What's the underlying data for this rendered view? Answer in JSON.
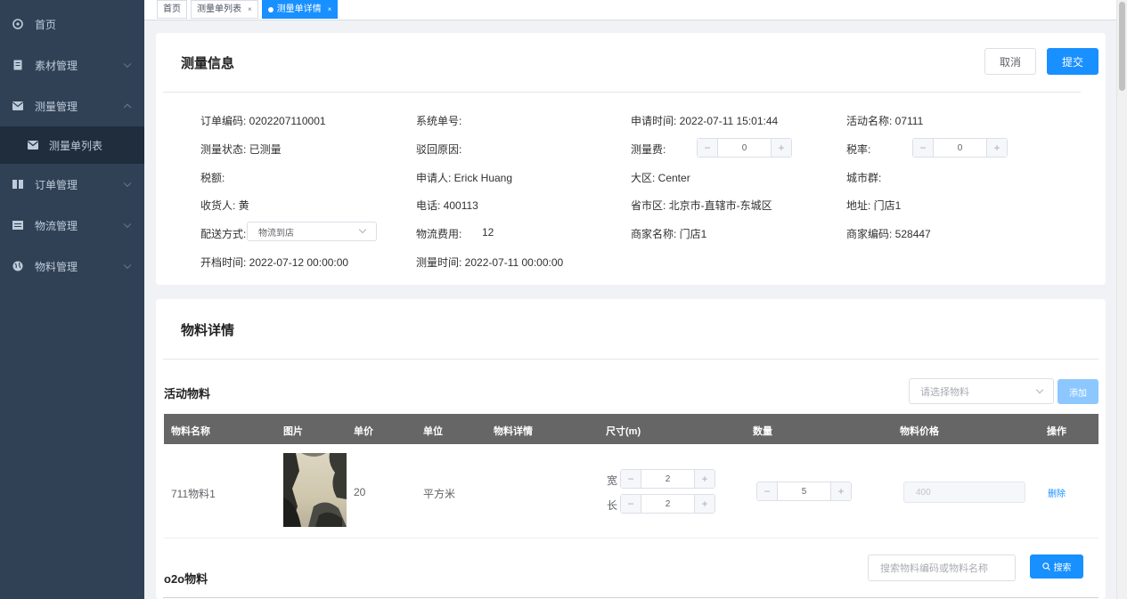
{
  "sidebar": {
    "items": [
      {
        "label": "首页",
        "icon": "dashboard-icon"
      },
      {
        "label": "素材管理",
        "icon": "document-icon"
      },
      {
        "label": "测量管理",
        "icon": "mail-icon"
      },
      {
        "label": "测量单列表",
        "icon": "mail-icon"
      },
      {
        "label": "订单管理",
        "icon": "book-icon"
      },
      {
        "label": "物流管理",
        "icon": "calendar-icon"
      },
      {
        "label": "物料管理",
        "icon": "globe-icon"
      }
    ]
  },
  "tags": {
    "home": "首页",
    "list": "测量单列表",
    "detail": "测量单详情",
    "close": "×"
  },
  "info": {
    "title": "测量信息",
    "cancel": "取消",
    "submit": "提交",
    "order_code": "订单编码: 0202207110001",
    "system_no": "系统单号:",
    "apply_time": "申请时间: 2022-07-11 15:01:44",
    "activity_name": "活动名称: 07111",
    "measure_status": "测量状态: 已测量",
    "reject_reason": "驳回原因:",
    "measure_fee_label": "测量费:",
    "measure_fee_value": "0",
    "tax_rate_label": "税率:",
    "tax_rate_value": "0",
    "tax_amount": "税额:",
    "applicant": "申请人: Erick Huang",
    "region": "大区: Center",
    "city_group": "城市群:",
    "receiver": "收货人: 黄",
    "phone": "电话: 400113",
    "province": "省市区: 北京市-直辖市-东城区",
    "address": "地址: 门店1",
    "delivery_label": "配送方式:",
    "delivery_value": "物流到店",
    "logistics_fee_label": "物流费用:",
    "logistics_fee_value": "12",
    "merchant_name": "商家名称: 门店1",
    "merchant_code": "商家编码: 528447",
    "open_time": "开档时间: 2022-07-12 00:00:00",
    "measure_time": "测量时间: 2022-07-11 00:00:00",
    "minus": "−",
    "plus": "+"
  },
  "material": {
    "title": "物料详情",
    "activity_section": "活动物料",
    "select_placeholder": "请选择物料",
    "add": "添加",
    "columns": [
      "物料名称",
      "图片",
      "单价",
      "单位",
      "物料详情",
      "尺寸(m)",
      "数量",
      "物料价格",
      "操作"
    ],
    "row": {
      "name": "711物料1",
      "price": "20",
      "unit": "平方米",
      "width_label": "宽",
      "width": "2",
      "length_label": "长",
      "length": "2",
      "quantity": "5",
      "total": "400",
      "delete": "删除"
    },
    "o2o_section": "o2o物料",
    "search_placeholder": "搜索物料编码或物料名称",
    "search": "搜索"
  }
}
